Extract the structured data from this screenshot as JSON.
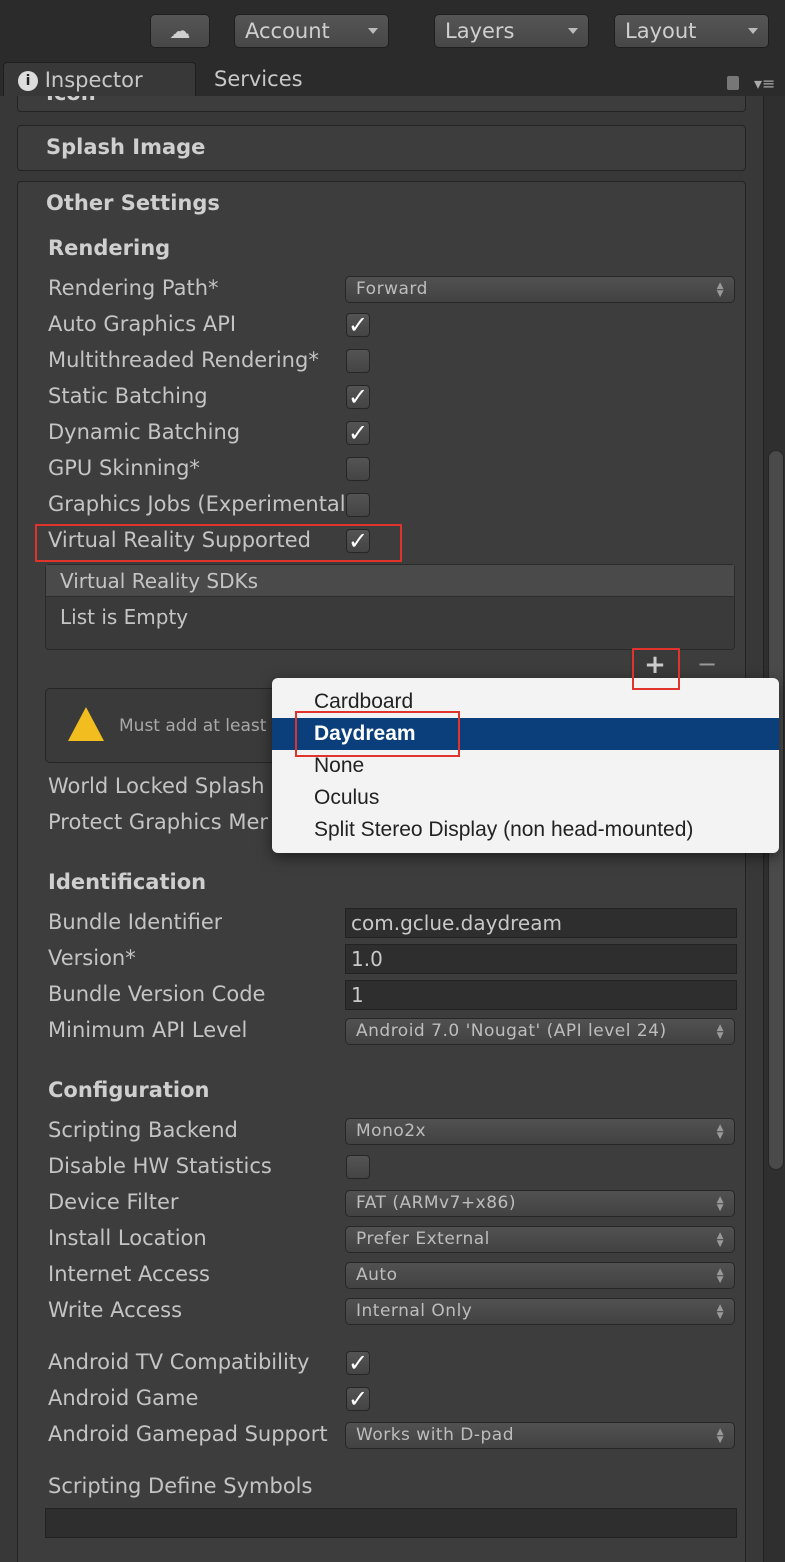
{
  "toolbar": {
    "cloud_icon": "cloud-icon",
    "account": "Account",
    "layers": "Layers",
    "layout": "Layout"
  },
  "tabs": {
    "inspector": "Inspector",
    "services": "Services",
    "info_icon": "i"
  },
  "sections": {
    "icon_partial": "Icon",
    "splash": "Splash Image",
    "other": "Other Settings"
  },
  "rendering": {
    "title": "Rendering",
    "rows": [
      {
        "label": "Rendering Path*",
        "type": "dropdown",
        "value": "Forward"
      },
      {
        "label": "Auto Graphics API",
        "type": "checkbox",
        "checked": true
      },
      {
        "label": "Multithreaded Rendering*",
        "type": "checkbox",
        "checked": false
      },
      {
        "label": "Static Batching",
        "type": "checkbox",
        "checked": true
      },
      {
        "label": "Dynamic Batching",
        "type": "checkbox",
        "checked": true
      },
      {
        "label": "GPU Skinning*",
        "type": "checkbox",
        "checked": false
      },
      {
        "label": "Graphics Jobs (Experimental)*",
        "type": "checkbox",
        "checked": false
      },
      {
        "label": "Virtual Reality Supported",
        "type": "checkbox",
        "checked": true
      }
    ],
    "sdk_list": {
      "header": "Virtual Reality SDKs",
      "empty": "List is Empty",
      "add": "+",
      "remove": "−"
    },
    "warning": "Must add at least one Virtual Reality SDK.",
    "rows2": [
      {
        "label": "World Locked Splash Screen",
        "type": "none"
      },
      {
        "label": "Protect Graphics Memory",
        "type": "none"
      }
    ]
  },
  "identification": {
    "title": "Identification",
    "rows": [
      {
        "label": "Bundle Identifier",
        "type": "text",
        "value": "com.gclue.daydream"
      },
      {
        "label": "Version*",
        "type": "text",
        "value": "1.0"
      },
      {
        "label": "Bundle Version Code",
        "type": "text",
        "value": "1"
      },
      {
        "label": "Minimum API Level",
        "type": "dropdown",
        "value": "Android 7.0 'Nougat' (API level 24)"
      }
    ]
  },
  "configuration": {
    "title": "Configuration",
    "rows": [
      {
        "label": "Scripting Backend",
        "type": "dropdown",
        "value": "Mono2x"
      },
      {
        "label": "Disable HW Statistics",
        "type": "checkbox",
        "checked": false
      },
      {
        "label": "Device Filter",
        "type": "dropdown",
        "value": "FAT (ARMv7+x86)"
      },
      {
        "label": "Install Location",
        "type": "dropdown",
        "value": "Prefer External"
      },
      {
        "label": "Internet Access",
        "type": "dropdown",
        "value": "Auto"
      },
      {
        "label": "Write Access",
        "type": "dropdown",
        "value": "Internal Only"
      },
      {
        "label": "Android TV Compatibility",
        "type": "checkbox",
        "checked": true
      },
      {
        "label": "Android Game",
        "type": "checkbox",
        "checked": true
      },
      {
        "label": "Android Gamepad Support",
        "type": "dropdown",
        "value": "Works with D-pad"
      }
    ],
    "define_label": "Scripting Define Symbols",
    "define_value": ""
  },
  "popup": {
    "items": [
      "Cardboard",
      "Daydream",
      "None",
      "Oculus",
      "Split Stereo Display (non head-mounted)"
    ],
    "selected": 1,
    "highlight_color": "#0b3f7c"
  },
  "annotation_color": "#e0332b"
}
